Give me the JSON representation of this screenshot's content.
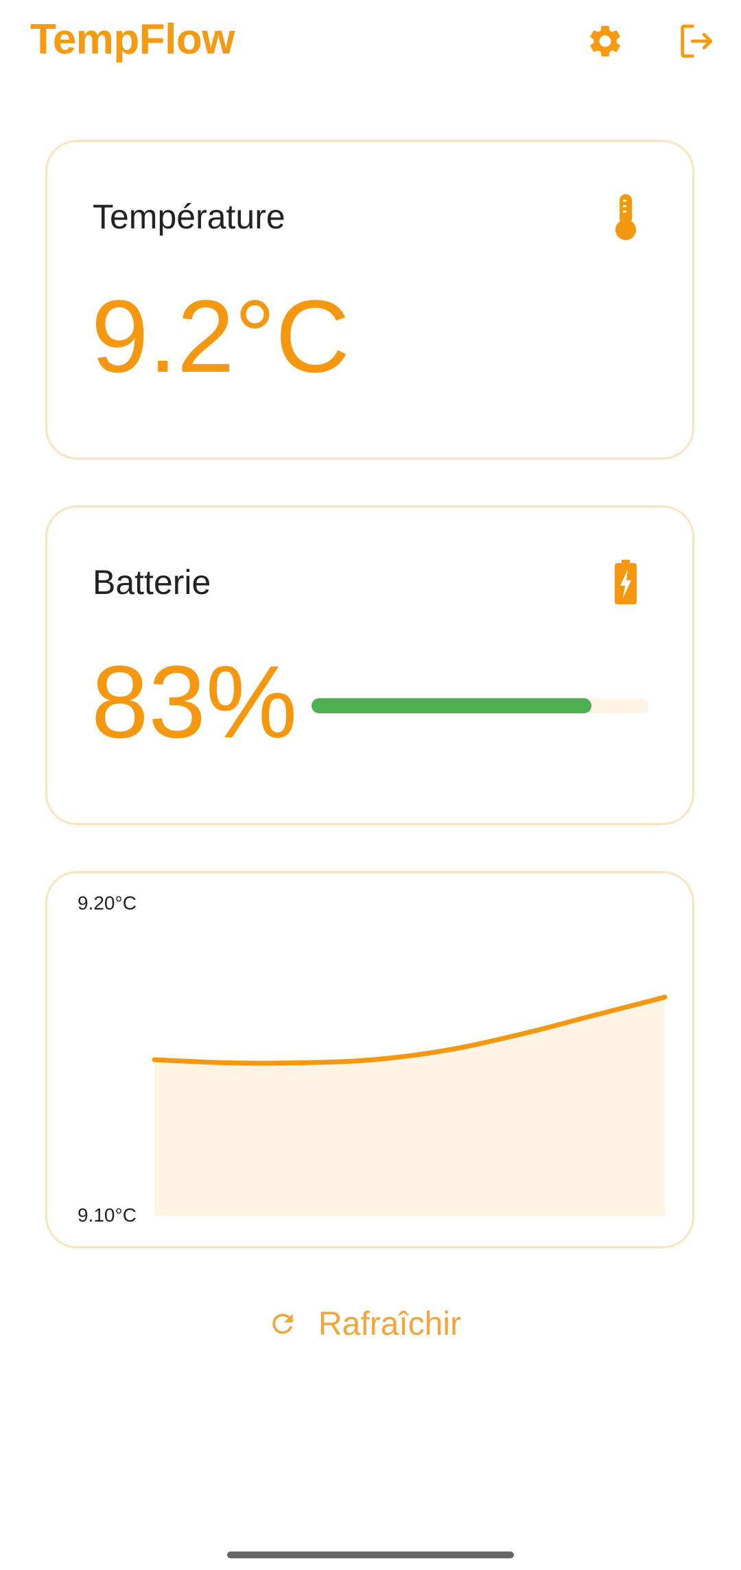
{
  "header": {
    "title": "TempFlow",
    "settings_icon": "gear-icon",
    "logout_icon": "logout-icon"
  },
  "temperature_card": {
    "label": "Température",
    "value": "9.2°C",
    "icon": "thermometer-icon"
  },
  "battery_card": {
    "label": "Batterie",
    "value": "83%",
    "percent": 83,
    "icon": "battery-charging-icon"
  },
  "chart_data": {
    "type": "area",
    "y_top_label": "9.20°C",
    "y_bottom_label": "9.10°C",
    "ylim": [
      9.1,
      9.2
    ],
    "values": [
      9.15,
      9.149,
      9.149,
      9.15,
      9.153,
      9.158,
      9.164,
      9.17
    ],
    "line_color": "#F5980F",
    "fill_color": "#FEF4E6"
  },
  "refresh": {
    "label": "Rafraîchir",
    "icon": "refresh-icon"
  },
  "colors": {
    "accent": "#F5980F",
    "card_border": "#FBE3BE",
    "battery_fill": "#4CAF50",
    "track": "#FEF4E6"
  }
}
